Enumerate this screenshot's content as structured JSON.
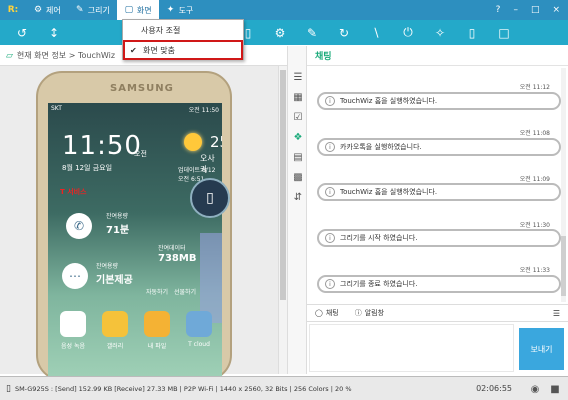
{
  "topbar": {
    "logo": "R:",
    "menu": [
      {
        "label": "제어",
        "icon": "control-icon"
      },
      {
        "label": "그리기",
        "icon": "pencil-icon"
      },
      {
        "label": "화면",
        "icon": "monitor-icon"
      },
      {
        "label": "도구",
        "icon": "tools-icon"
      }
    ],
    "controls": [
      "?",
      "–",
      "□",
      "×"
    ]
  },
  "dropdown": {
    "items": [
      {
        "label": "사용자 조절"
      },
      {
        "label": "화면 맞춤",
        "checked": true
      }
    ]
  },
  "breadcrumb": {
    "text": "현재 화면 정보 > TouchWiz"
  },
  "phone": {
    "brand": "SAMSUNG",
    "status_left": "SKT",
    "status_right": "오전 11:50",
    "clock": "11:50",
    "ampm": "오전",
    "date": "8월 12일 금요일",
    "temp": "25°",
    "location": "오사카",
    "updated": "업데이트 8/12 오전 6:51",
    "carrier": "T 서비스",
    "widget1_small": "잔여용량",
    "widget1_big": "71분",
    "widget2_small": "잔여데이터",
    "widget2_big": "738MB",
    "widget3_small": "잔여용량",
    "widget3_big": "기본제공",
    "widget_foot_left": "자동하기",
    "widget_foot_right": "선물하기",
    "dock": [
      {
        "label": "음성 녹음",
        "color": "#ffffff"
      },
      {
        "label": "갤러리",
        "color": "#f5c23a"
      },
      {
        "label": "내 파일",
        "color": "#f4b234"
      },
      {
        "label": "T cloud",
        "color": "#6fa9d8"
      }
    ]
  },
  "chat": {
    "title": "채팅",
    "messages": [
      {
        "time": "오전 11:12",
        "text": "TouchWiz 홈을 실행하였습니다."
      },
      {
        "time": "오전 11:08",
        "text": "카카오톡을 실행하였습니다."
      },
      {
        "time": "오전 11:09",
        "text": "TouchWiz 홈을 실행하였습니다."
      },
      {
        "time": "오전 11:30",
        "text": "그리기를 시작 하였습니다."
      },
      {
        "time": "오전 11:33",
        "text": "그리기를 종료 하였습니다."
      }
    ],
    "tabs": [
      "채팅",
      "알림창"
    ],
    "send": "보내기"
  },
  "statusbar": {
    "info": "SM-G925S : [Send] 152.99 KB  [Receive] 27.33 MB | P2P Wi-Fi | 1440 x 2560, 32 Bits | 256 Colors | 20 %",
    "time": "02:06:55"
  },
  "colors": {
    "topbar": "#2d8fbf",
    "toolbar": "#24a9c9",
    "accent": "#1aaa7a",
    "send": "#3aa7de",
    "highlight": "#d01818"
  }
}
